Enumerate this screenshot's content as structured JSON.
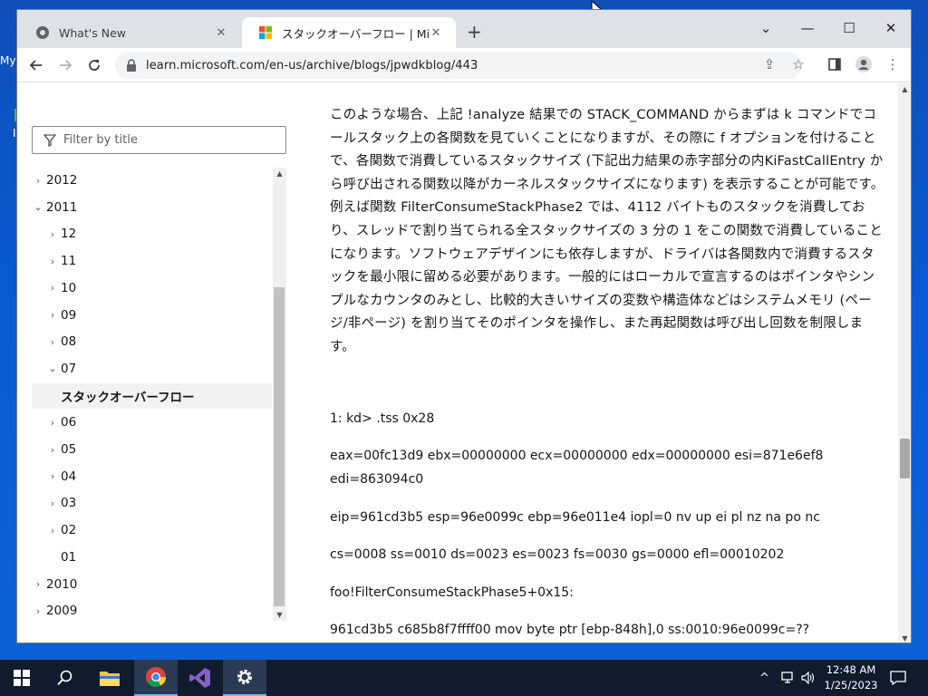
{
  "desktop": {
    "icon_label_fragment": "My",
    "icon_label_fragment2": "I"
  },
  "browser": {
    "tabs": [
      {
        "title": "What's New",
        "active": false
      },
      {
        "title": "スタックオーバーフロー | Microsoft Lea",
        "active": true
      }
    ],
    "new_tab": "+",
    "window_controls": {
      "minimize": "—",
      "maximize": "☐",
      "close": "✕",
      "menu": "⌄"
    },
    "url": "learn.microsoft.com/en-us/archive/blogs/jpwdkblog/443"
  },
  "sidebar": {
    "filter_placeholder": "Filter by title",
    "items": [
      {
        "label": "2012",
        "state": "collapsed",
        "level": 0
      },
      {
        "label": "2011",
        "state": "expanded",
        "level": 0
      },
      {
        "label": "12",
        "state": "collapsed",
        "level": 1
      },
      {
        "label": "11",
        "state": "collapsed",
        "level": 1
      },
      {
        "label": "10",
        "state": "collapsed",
        "level": 1
      },
      {
        "label": "09",
        "state": "collapsed",
        "level": 1
      },
      {
        "label": "08",
        "state": "collapsed",
        "level": 1
      },
      {
        "label": "07",
        "state": "expanded",
        "level": 1
      },
      {
        "label": "スタックオーバーフロー",
        "state": "selected",
        "level": 2
      },
      {
        "label": "06",
        "state": "collapsed",
        "level": 1
      },
      {
        "label": "05",
        "state": "collapsed",
        "level": 1
      },
      {
        "label": "04",
        "state": "collapsed",
        "level": 1
      },
      {
        "label": "03",
        "state": "collapsed",
        "level": 1
      },
      {
        "label": "02",
        "state": "collapsed",
        "level": 1
      },
      {
        "label": "01",
        "state": "leaf",
        "level": 1
      },
      {
        "label": "2010",
        "state": "collapsed",
        "level": 0
      },
      {
        "label": "2009",
        "state": "collapsed",
        "level": 0
      }
    ]
  },
  "article": {
    "paragraph": "このような場合、上記 !analyze 結果での STACK_COMMAND からまずは k コマンドでコールスタック上の各関数を見ていくことになりますが、その際に f オプションを付けることで、各関数で消費しているスタックサイズ (下記出力結果の赤字部分の内KiFastCallEntry から呼び出される関数以降がカーネルスタックサイズになります) を表示することが可能です。例えば関数 FilterConsumeStackPhase2 では、4112 バイトものスタックを消費しており、スレッドで割り当てられる全スタックサイズの 3 分の 1 をこの関数で消費していることになります。ソフトウェアデザインにも依存しますが、ドライバは各関数内で消費するスタックを最小限に留める必要があります。一般的にはローカルで宣言するのはポインタやシンプルなカウンタのみとし、比較的大きいサイズの変数や構造体などはシステムメモリ (ページ/非ページ) を割り当てそのポインタを操作し、また再起関数は呼び出し回数を制限します。",
    "code_lines": [
      "1: kd> .tss 0x28",
      "eax=00fc13d9 ebx=00000000 ecx=00000000 edx=00000000 esi=871e6ef8",
      "edi=863094c0",
      "eip=961cd3b5 esp=96e0099c ebp=96e011e4 iopl=0 nv up ei pl nz na po nc",
      "cs=0008 ss=0010 ds=0023 es=0023 fs=0030 gs=0000 efl=00010202",
      "foo!FilterConsumeStackPhase5+0x15:",
      "961cd3b5 c685b8f7ffff00 mov byte ptr [ebp-848h],0 ss:0010:96e0099c=??"
    ]
  },
  "taskbar": {
    "apps": [
      "start-icon",
      "search-icon",
      "file-explorer-icon",
      "chrome-icon",
      "visual-studio-icon",
      "settings-icon"
    ],
    "tray_chevron": "^",
    "clock_time": "12:48 AM",
    "clock_date": "1/25/2023"
  },
  "colors": {
    "titlebar": "#dee1e6",
    "taskbar": "#101b2d",
    "desktop": "#0a5ad4"
  }
}
